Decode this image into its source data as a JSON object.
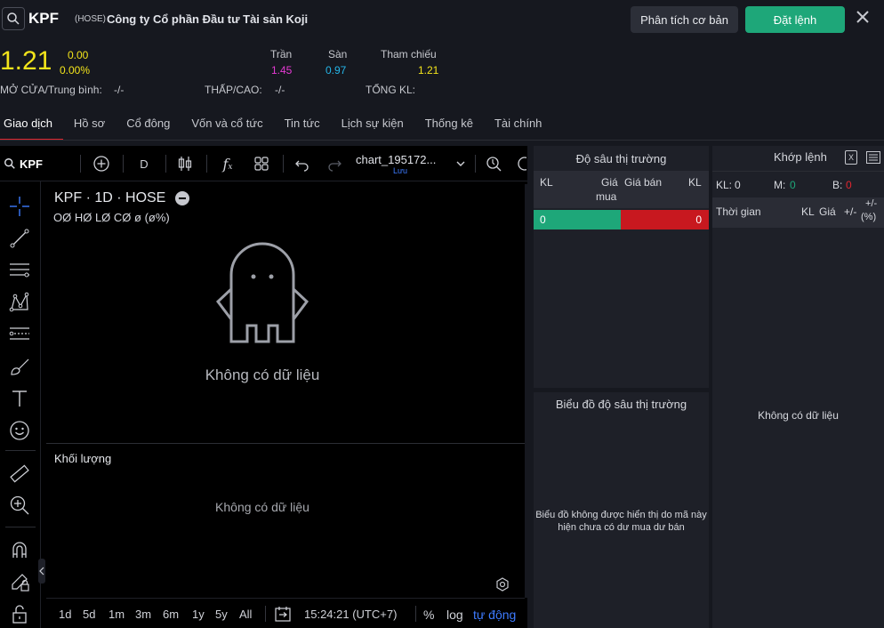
{
  "header": {
    "ticker": "KPF",
    "exchange": "(HOSE)",
    "company": "Công ty Cổ phần Đầu tư Tài sản Koji",
    "analysis_button": "Phân tích cơ bản",
    "order_button": "Đặt lệnh"
  },
  "quote": {
    "price": "1.21",
    "change": "0.00",
    "change_pct": "0.00%",
    "ceiling_label": "Trần",
    "ceiling": "1.45",
    "floor_label": "Sàn",
    "floor": "0.97",
    "ref_label": "Tham chiếu",
    "ref": "1.21",
    "open_label": "MỞ CỬA/Trung bình:",
    "open_value": "-/-",
    "lowhigh_label": "THẤP/CAO:",
    "lowhigh_value": "-/-",
    "volume_label": "TỔNG KL:"
  },
  "tabs": [
    {
      "label": "Giao dịch"
    },
    {
      "label": "Hồ sơ"
    },
    {
      "label": "Cổ đông"
    },
    {
      "label": "Vốn và cổ tức"
    },
    {
      "label": "Tin tức"
    },
    {
      "label": "Lịch sự kiện"
    },
    {
      "label": "Thống kê"
    },
    {
      "label": "Tài chính"
    }
  ],
  "chart": {
    "symbol_search": "KPF",
    "interval": "D",
    "layout_name": "chart_195172...",
    "save_label": "Lưu",
    "title": "KPF · 1D · HOSE",
    "ohlc": "OØ HØ LØ CØ ø (ø%)",
    "no_data": "Không có dữ liệu",
    "volume_title": "Khối lượng",
    "volume_no_data": "Không có dữ liệu",
    "ranges": [
      "1d",
      "5d",
      "1m",
      "3m",
      "6m",
      "1y",
      "5y",
      "All"
    ],
    "clock": "15:24:21 (UTC+7)",
    "pct_label": "%",
    "log_label": "log",
    "auto_label": "tự động"
  },
  "depth": {
    "title": "Độ sâu thị trường",
    "col_vol_buy": "KL",
    "col_buy_price_1": "Giá",
    "col_buy_price_2": "mua",
    "col_sell_price": "Giá bán",
    "col_vol_sell": "KL",
    "buy_value": "0",
    "sell_value": "0",
    "chart_title": "Biểu đồ độ sâu thị trường",
    "chart_message": "Biểu đồ không được hiển thị do mã này hiện chưa có dư mua dư bán"
  },
  "matched": {
    "title": "Khớp lệnh",
    "kl_label": "KL:",
    "kl_value": "0",
    "m_label": "M:",
    "m_value": "0",
    "b_label": "B:",
    "b_value": "0",
    "col_time": "Thời gian",
    "col_vol": "KL",
    "col_price": "Giá",
    "col_change_1": "+/-",
    "col_change_2": "+/-",
    "col_change_3": "(%)",
    "no_data": "Không có dữ liệu"
  },
  "colors": {
    "up": "#1ea779",
    "down": "#c8181f",
    "ref": "#f3e41b",
    "ceiling": "#e63ad4",
    "floor": "#25b5e8",
    "accent_blue": "#3d7bff"
  }
}
